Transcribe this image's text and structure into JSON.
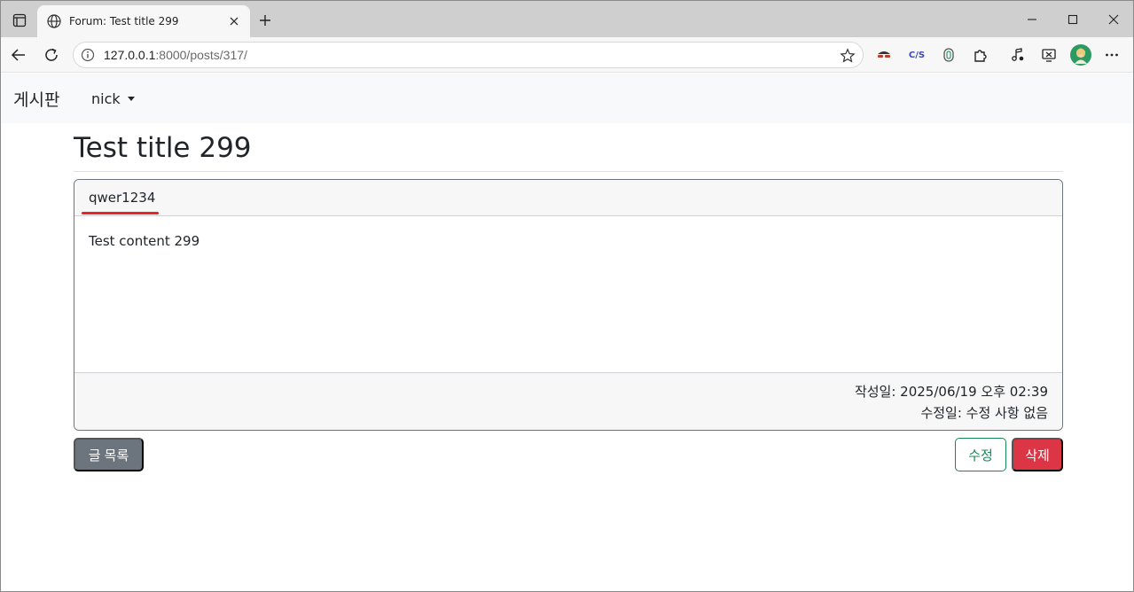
{
  "browser": {
    "tab_title": "Forum: Test title 299",
    "url_host": "127.0.0.1",
    "url_rest": ":8000/posts/317/",
    "ext_cjs_label": "C/S"
  },
  "navbar": {
    "brand": "게시판",
    "user": "nick"
  },
  "post": {
    "title": "Test title 299",
    "author": "qwer1234",
    "content": "Test content 299",
    "created": "작성일: 2025/06/19 오후 02:39",
    "modified": "수정일: 수정 사항 없음"
  },
  "buttons": {
    "list": "글 목록",
    "edit": "수정",
    "delete": "삭제"
  },
  "colors": {
    "secondary": "#6c757d",
    "success": "#198754",
    "danger": "#dc3545",
    "highlight": "#e5252a"
  }
}
